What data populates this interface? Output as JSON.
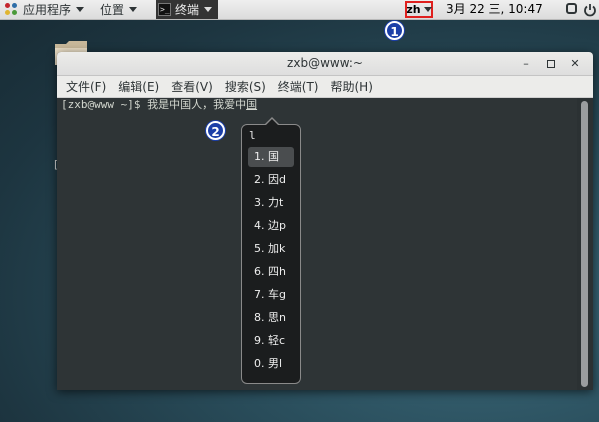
{
  "top_panel": {
    "apps_label": "应用程序",
    "places_label": "位置",
    "task_label": "终端",
    "input_method": "zh",
    "clock": "3月 22 三, 10:47"
  },
  "callouts": [
    "1",
    "2"
  ],
  "terminal": {
    "title": "zxb@www:~",
    "menu": [
      "文件(F)",
      "编辑(E)",
      "查看(V)",
      "搜索(S)",
      "终端(T)",
      "帮助(H)"
    ],
    "prompt": "[zxb@www ~]$ ",
    "committed_text": "我是中国人，我爱中",
    "preedit_text": "国"
  },
  "ime": {
    "preedit": "l",
    "selected_index": 0,
    "candidates": [
      "1. 国",
      "2. 因d",
      "3. 力t",
      "4. 边p",
      "5. 加k",
      "6. 四h",
      "7. 车g",
      "8. 思n",
      "9. 轻c",
      "0. 男l"
    ]
  },
  "colors": {
    "accent_highlight": "#e0201e",
    "badge": "#1c3fa8",
    "terminal_bg": "#2e3436"
  }
}
